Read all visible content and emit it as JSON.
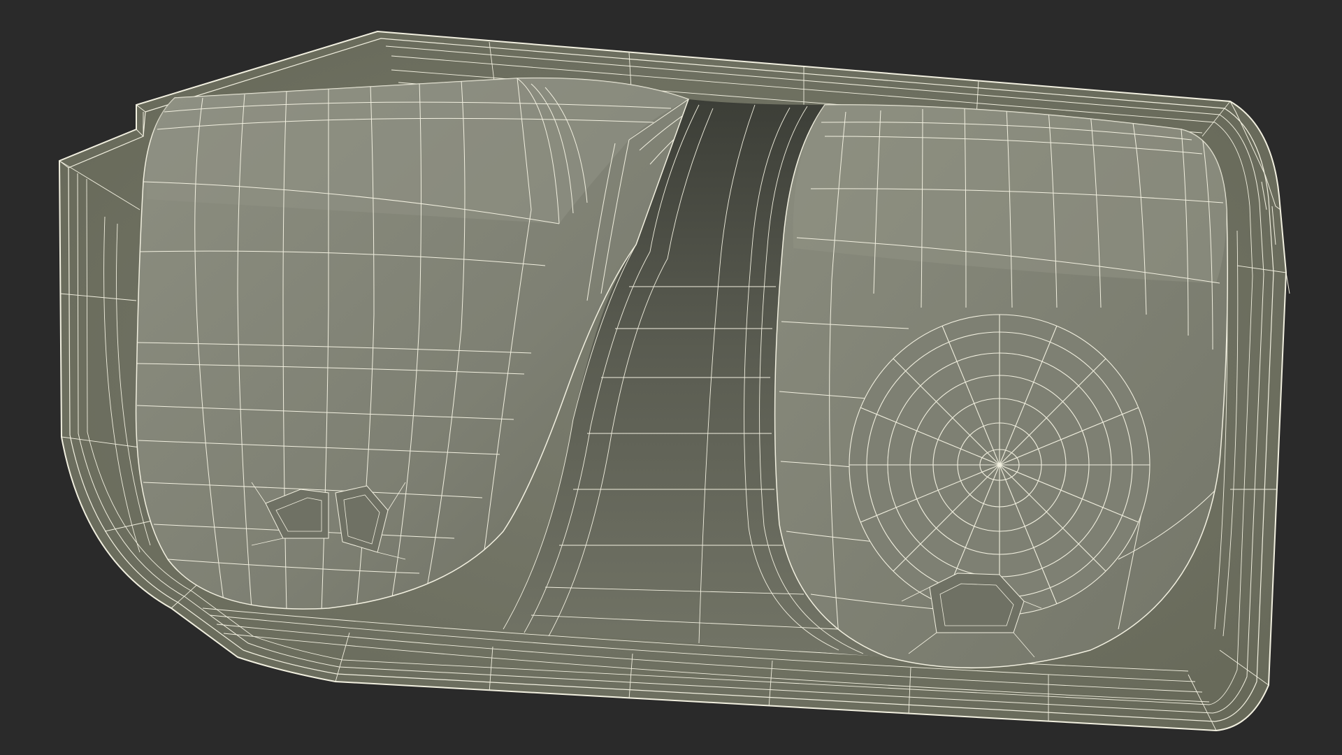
{
  "scene": {
    "subject": "wireframe-tray-model",
    "colors": {
      "background": "#2a2a2a",
      "surface_light": "#8b8d7f",
      "surface_mid": "#737567",
      "surface_dark": "#4f5148",
      "shadow": "#3a3c35",
      "wire": "#f2f0e0"
    }
  }
}
